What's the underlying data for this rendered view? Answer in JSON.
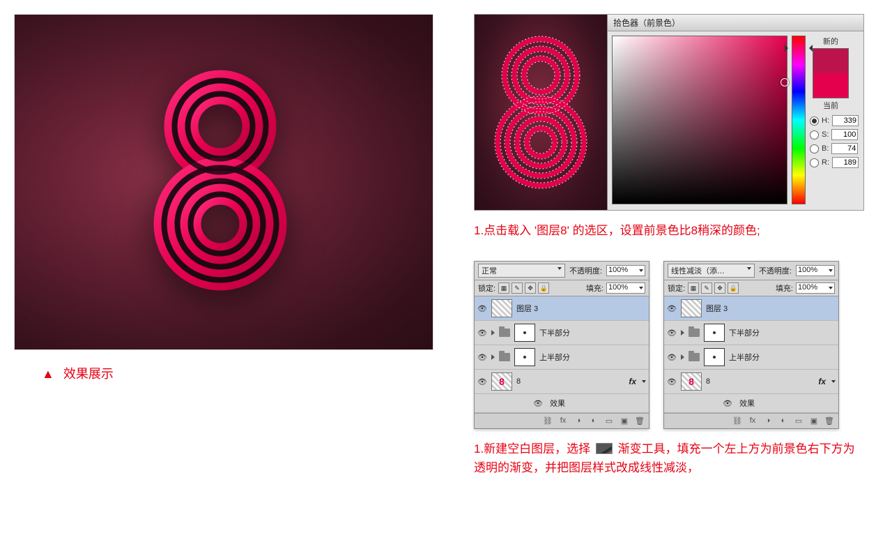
{
  "left": {
    "caption": "效果展示"
  },
  "picker": {
    "title": "拾色器（前景色）",
    "new_label": "新的",
    "current_label": "当前",
    "H": "339",
    "S": "100",
    "B": "74",
    "R": "189",
    "new_color": "#bd134d",
    "current_color": "#e5004e"
  },
  "instruction1": "1.点击载入 '图层8' 的选区，设置前景色比8稍深的颜色;",
  "instruction2_a": "1.新建空白图层，选择",
  "instruction2_b": "渐变工具，填充一个左上方为前景色右下方为透明的渐变，并把图层样式改成线性减淡，",
  "panel1": {
    "blend": "正常",
    "opacity_label": "不透明度:",
    "opacity": "100%",
    "lock_label": "锁定:",
    "fill_label": "填充:",
    "fill": "100%",
    "layers": {
      "l1": "图层 3",
      "l2": "下半部分",
      "l3": "上半部分",
      "l4": "8",
      "l5": "效果"
    }
  },
  "panel2": {
    "blend": "线性减淡（添…",
    "opacity_label": "不透明度:",
    "opacity": "100%",
    "lock_label": "锁定:",
    "fill_label": "填充:",
    "fill": "100%",
    "layers": {
      "l1": "图层 3",
      "l2": "下半部分",
      "l3": "上半部分",
      "l4": "8",
      "l5": "效果"
    }
  },
  "labels": {
    "H": "H:",
    "S": "S:",
    "B": "B:",
    "R": "R:"
  }
}
